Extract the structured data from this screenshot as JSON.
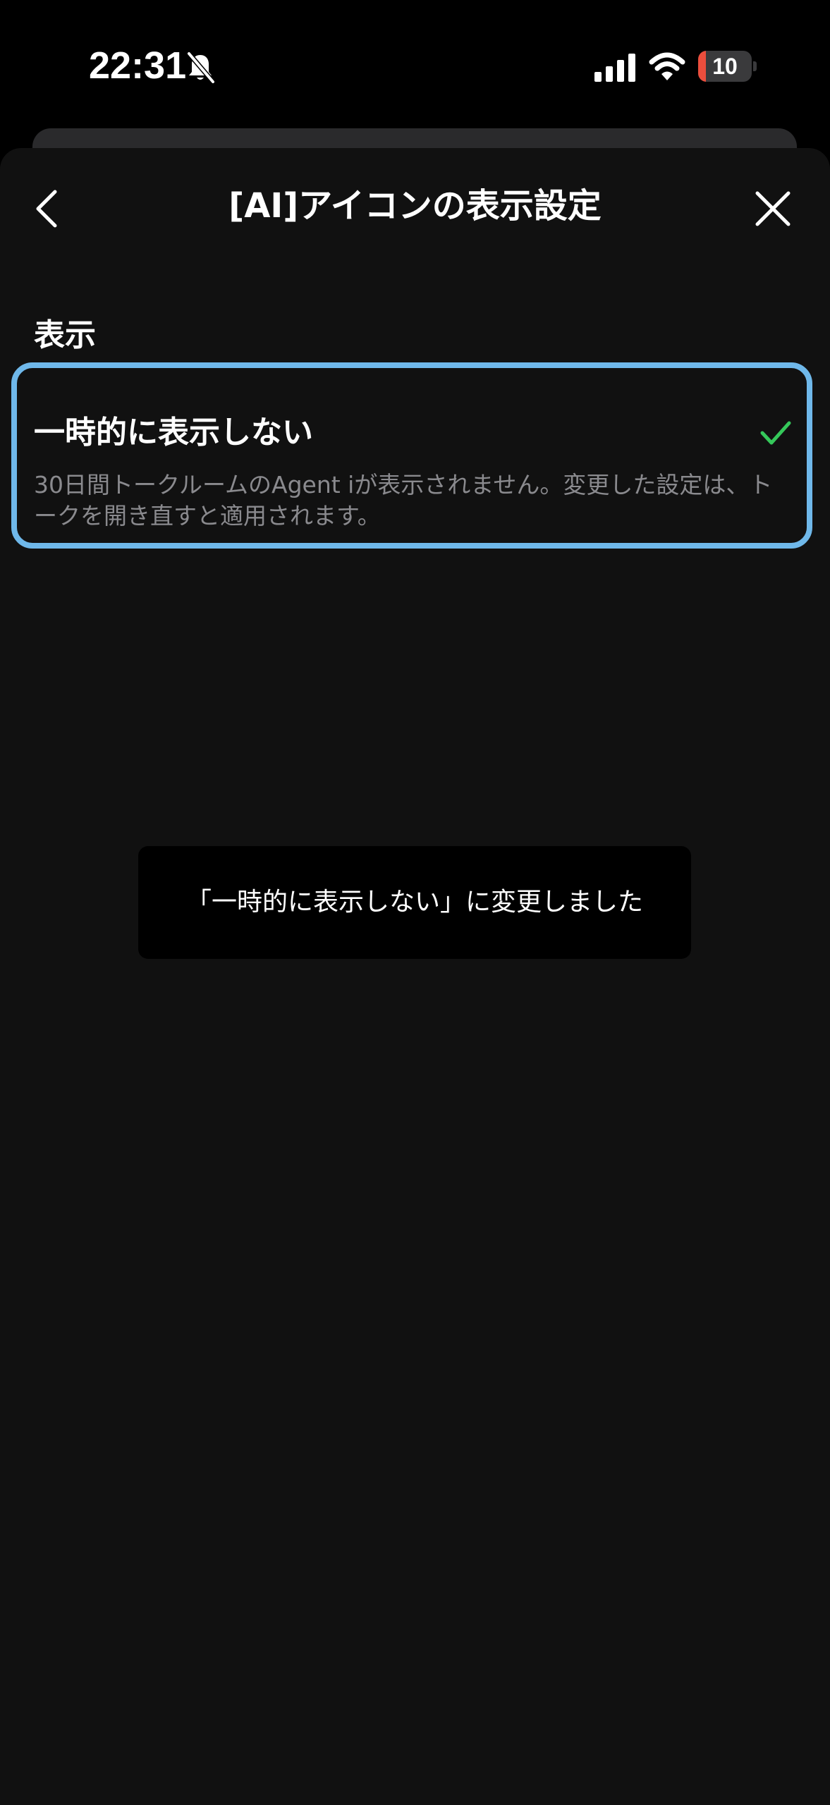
{
  "status_bar": {
    "time": "22:31",
    "battery_level": "10",
    "battery_fraction": 0.1,
    "icons": [
      "bell-slash-icon",
      "cellular-signal-icon",
      "wifi-icon",
      "battery-icon"
    ]
  },
  "header": {
    "title": "[AI]アイコンの表示設定",
    "back_icon": "chevron-left-icon",
    "close_icon": "close-icon"
  },
  "section": {
    "label": "表示"
  },
  "option": {
    "title": "一時的に表示しない",
    "description": "30日間トークルームのAgent iが表示されません。変更した設定は、トークを開き直すと適用されます。",
    "selected": true,
    "check_icon": "checkmark-icon"
  },
  "toast": {
    "message": "「一時的に表示しない」に変更しました"
  },
  "colors": {
    "background": "#000000",
    "sheet": "#111111",
    "highlight_border": "#6fb8ea",
    "check": "#35c85a",
    "secondary_text": "#8a8a8e",
    "battery_low": "#eb4e3d"
  }
}
